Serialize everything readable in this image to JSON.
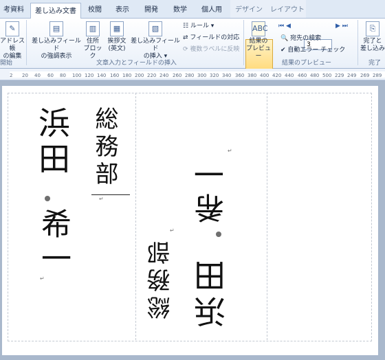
{
  "tabs": [
    "考資料",
    "差し込み文書",
    "校閲",
    "表示",
    "開発",
    "数学",
    "個人用",
    "デザイン",
    "レイアウト"
  ],
  "active_tab": "差し込み文書",
  "ribbon": {
    "address_edit": [
      "アドレス帳",
      "の編集"
    ],
    "highlight": [
      "差し込みフィールド",
      "の強調表示"
    ],
    "address_block": [
      "住所",
      "ブロック"
    ],
    "greeting": [
      "挨拶文",
      "(英文)"
    ],
    "insert_field": [
      "差し込みフィールド",
      "の挿入 ▾"
    ],
    "rules": "ルール ▾",
    "match_fields": "フィールドの対応",
    "update_labels": "複数ラベルに反映",
    "group_write": "文章入力とフィールドの挿入",
    "preview": [
      "結果の",
      "プレビュー"
    ],
    "record_number": "3",
    "find_recipient": "宛先の検索",
    "auto_check": "自動エラー チェック",
    "group_preview": "結果のプレビュー",
    "finish": [
      "完了と",
      "差し込み"
    ],
    "group_finish": "完了",
    "group_start": "開始"
  },
  "ruler_ticks": [
    "2",
    "20",
    "40",
    "60",
    "80",
    "100",
    "120",
    "140",
    "160",
    "180",
    "200",
    "220",
    "240",
    "260",
    "280",
    "300",
    "320",
    "340",
    "360",
    "380",
    "400",
    "420",
    "440",
    "460",
    "480",
    "500",
    "229",
    "249",
    "269",
    "289"
  ],
  "labels": {
    "left": {
      "name_family": "浜田",
      "name_given": "希一",
      "dept": "総務部"
    },
    "right": {
      "name_family": "浜田",
      "name_given": "希一",
      "dept": "総務部"
    }
  }
}
